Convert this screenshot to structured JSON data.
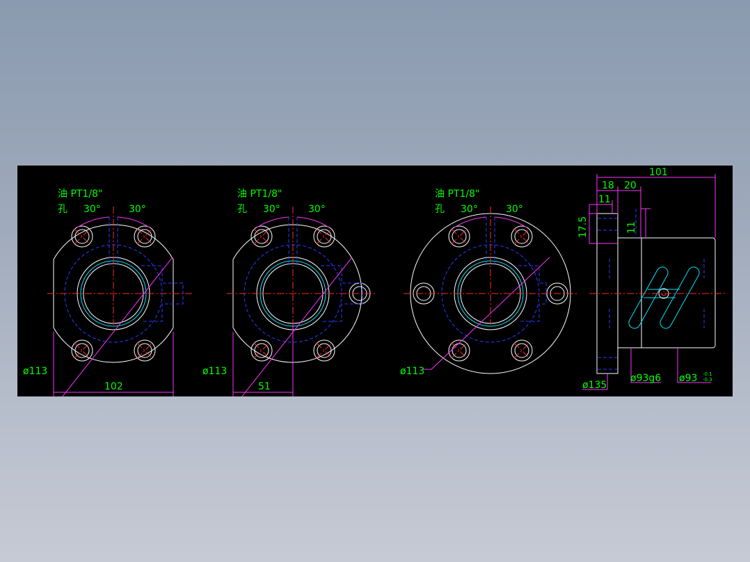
{
  "drawing": {
    "views": [
      {
        "oil_hole_line1": "油 PT1/8\"",
        "oil_hole_line2": "孔",
        "angle_left": "30°",
        "angle_right": "30°",
        "pcd": "ø113",
        "width": "102"
      },
      {
        "oil_hole_line1": "油 PT1/8\"",
        "oil_hole_line2": "孔",
        "angle_left": "30°",
        "angle_right": "30°",
        "pcd": "ø113",
        "width": "51"
      },
      {
        "oil_hole_line1": "油 PT1/8\"",
        "oil_hole_line2": "孔",
        "angle_left": "30°",
        "angle_right": "30°",
        "pcd": "ø113"
      }
    ],
    "side_view": {
      "overall_length": "101",
      "dim_18": "18",
      "dim_20": "20",
      "dim_11_top": "11",
      "dim_11_vertical": "11",
      "dim_17_5": "17.5",
      "flange_dia": "ø135",
      "spigot_dia": "ø93g6",
      "body_dia": "ø93",
      "body_tol_upper": "-0.1",
      "body_tol_lower": "-0.3"
    }
  },
  "colors": {
    "background": "#000000",
    "outline": "#ffffff",
    "dimension": "#ff33ff",
    "text": "#00ff00",
    "hidden": "#2a3cff",
    "centerline": "#ff2a2a",
    "thread": "#00e5ff"
  }
}
